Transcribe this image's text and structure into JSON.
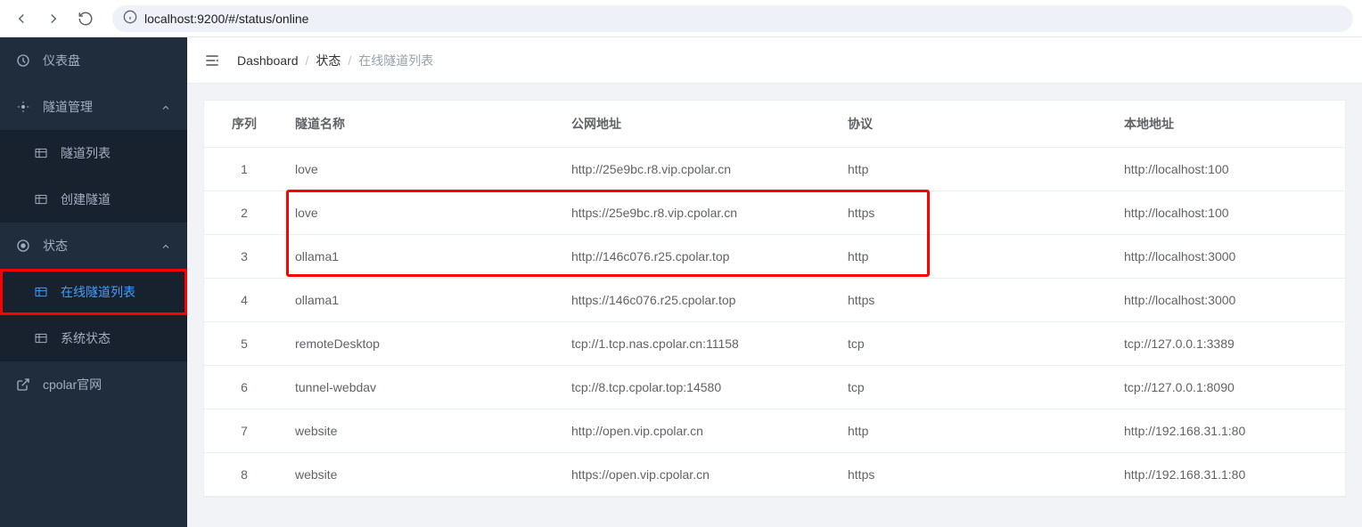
{
  "browser": {
    "url": "localhost:9200/#/status/online"
  },
  "sidebar": {
    "items": [
      {
        "label": "仪表盘",
        "icon": "dashboard"
      },
      {
        "label": "隧道管理",
        "icon": "manage",
        "expandable": true
      },
      {
        "label": "隧道列表",
        "icon": "table",
        "sub": true
      },
      {
        "label": "创建隧道",
        "icon": "table",
        "sub": true
      },
      {
        "label": "状态",
        "icon": "status",
        "expandable": true
      },
      {
        "label": "在线隧道列表",
        "icon": "table",
        "sub": true,
        "active": true,
        "highlighted": true
      },
      {
        "label": "系统状态",
        "icon": "table",
        "sub": true
      },
      {
        "label": "cpolar官网",
        "icon": "external"
      }
    ]
  },
  "breadcrumb": {
    "items": [
      {
        "label": "Dashboard",
        "muted": false
      },
      {
        "label": "状态",
        "muted": false
      },
      {
        "label": "在线隧道列表",
        "muted": true
      }
    ]
  },
  "table": {
    "headers": {
      "seq": "序列",
      "name": "隧道名称",
      "url": "公网地址",
      "proto": "协议",
      "local": "本地地址"
    },
    "rows": [
      {
        "seq": "1",
        "name": "love",
        "url": "http://25e9bc.r8.vip.cpolar.cn",
        "proto": "http",
        "local": "http://localhost:100"
      },
      {
        "seq": "2",
        "name": "love",
        "url": "https://25e9bc.r8.vip.cpolar.cn",
        "proto": "https",
        "local": "http://localhost:100"
      },
      {
        "seq": "3",
        "name": "ollama1",
        "url": "http://146c076.r25.cpolar.top",
        "proto": "http",
        "local": "http://localhost:3000"
      },
      {
        "seq": "4",
        "name": "ollama1",
        "url": "https://146c076.r25.cpolar.top",
        "proto": "https",
        "local": "http://localhost:3000"
      },
      {
        "seq": "5",
        "name": "remoteDesktop",
        "url": "tcp://1.tcp.nas.cpolar.cn:11158",
        "proto": "tcp",
        "local": "tcp://127.0.0.1:3389"
      },
      {
        "seq": "6",
        "name": "tunnel-webdav",
        "url": "tcp://8.tcp.cpolar.top:14580",
        "proto": "tcp",
        "local": "tcp://127.0.0.1:8090"
      },
      {
        "seq": "7",
        "name": "website",
        "url": "http://open.vip.cpolar.cn",
        "proto": "http",
        "local": "http://192.168.31.1:80"
      },
      {
        "seq": "8",
        "name": "website",
        "url": "https://open.vip.cpolar.cn",
        "proto": "https",
        "local": "http://192.168.31.1:80"
      }
    ]
  }
}
